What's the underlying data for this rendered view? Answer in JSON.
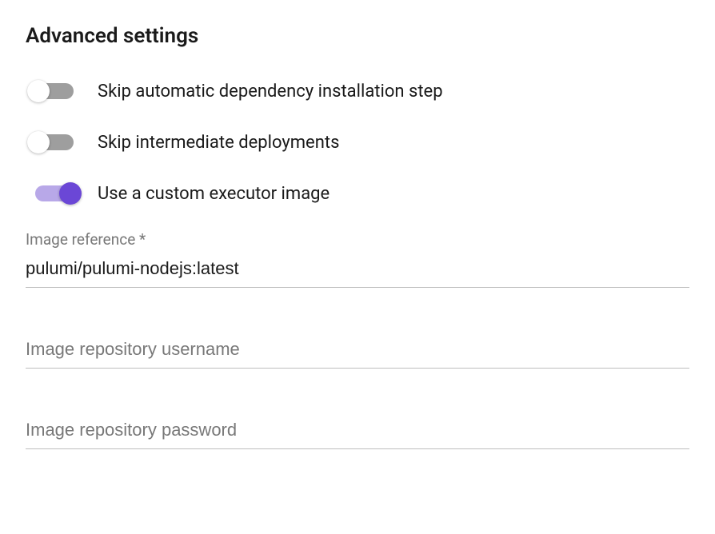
{
  "section": {
    "title": "Advanced settings"
  },
  "toggles": {
    "skip_dependency": {
      "label": "Skip automatic dependency installation step",
      "on": false
    },
    "skip_intermediate": {
      "label": "Skip intermediate deployments",
      "on": false
    },
    "custom_executor": {
      "label": "Use a custom executor image",
      "on": true
    }
  },
  "fields": {
    "image_reference": {
      "label": "Image reference *",
      "value": "pulumi/pulumi-nodejs:latest"
    },
    "repo_username": {
      "placeholder": "Image repository username",
      "value": ""
    },
    "repo_password": {
      "placeholder": "Image repository password",
      "value": ""
    }
  }
}
